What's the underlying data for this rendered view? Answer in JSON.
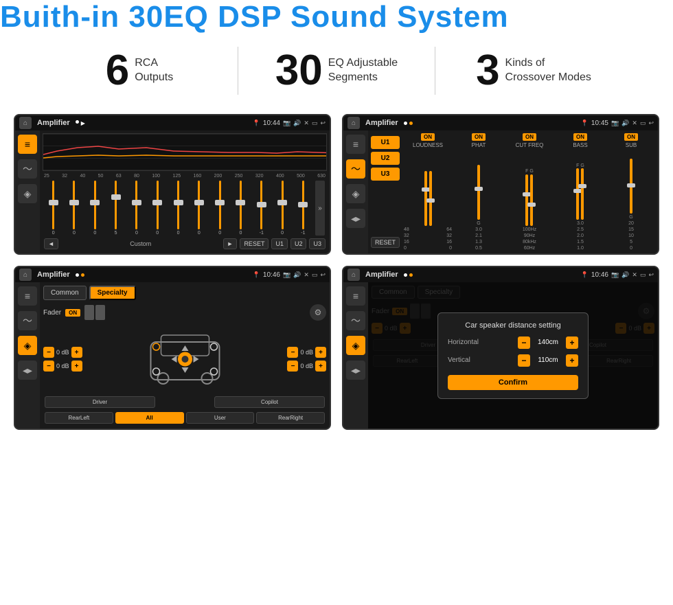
{
  "header": {
    "title": "Buith-in 30EQ DSP Sound System"
  },
  "stats": [
    {
      "number": "6",
      "line1": "RCA",
      "line2": "Outputs"
    },
    {
      "number": "30",
      "line1": "EQ Adjustable",
      "line2": "Segments"
    },
    {
      "number": "3",
      "line1": "Kinds of",
      "line2": "Crossover Modes"
    }
  ],
  "screens": {
    "eq": {
      "app_name": "Amplifier",
      "time": "10:44",
      "freq_labels": [
        "25",
        "32",
        "40",
        "50",
        "63",
        "80",
        "100",
        "125",
        "160",
        "200",
        "250",
        "320",
        "400",
        "500",
        "630"
      ],
      "values": [
        "0",
        "0",
        "0",
        "5",
        "0",
        "0",
        "0",
        "0",
        "0",
        "0",
        "-1",
        "0",
        "-1"
      ],
      "preset": "Custom",
      "buttons": [
        "RESET",
        "U1",
        "U2",
        "U3"
      ]
    },
    "crossover": {
      "app_name": "Amplifier",
      "time": "10:45",
      "presets": [
        "U1",
        "U2",
        "U3"
      ],
      "channels": [
        {
          "label": "LOUDNESS",
          "on": true
        },
        {
          "label": "PHAT",
          "on": true
        },
        {
          "label": "CUT FREQ",
          "on": true
        },
        {
          "label": "BASS",
          "on": true
        },
        {
          "label": "SUB",
          "on": true
        }
      ],
      "reset_label": "RESET"
    },
    "speaker": {
      "app_name": "Amplifier",
      "time": "10:46",
      "tabs": [
        "Common",
        "Specialty"
      ],
      "fader_label": "Fader",
      "fader_on": "ON",
      "positions": [
        "Driver",
        "Copilot",
        "RearLeft",
        "RearRight"
      ],
      "all_btn": "All",
      "user_btn": "User",
      "vol_values": [
        "0 dB",
        "0 dB",
        "0 dB",
        "0 dB"
      ]
    },
    "speaker_dialog": {
      "app_name": "Amplifier",
      "time": "10:46",
      "tabs": [
        "Common",
        "Specialty"
      ],
      "dialog": {
        "title": "Car speaker distance setting",
        "horizontal_label": "Horizontal",
        "horizontal_value": "140cm",
        "vertical_label": "Vertical",
        "vertical_value": "110cm",
        "confirm_label": "Confirm"
      },
      "positions": [
        "Driver",
        "Copilot",
        "RearLeft",
        "RearRight"
      ],
      "vol_values": [
        "0 dB",
        "0 dB"
      ]
    }
  }
}
